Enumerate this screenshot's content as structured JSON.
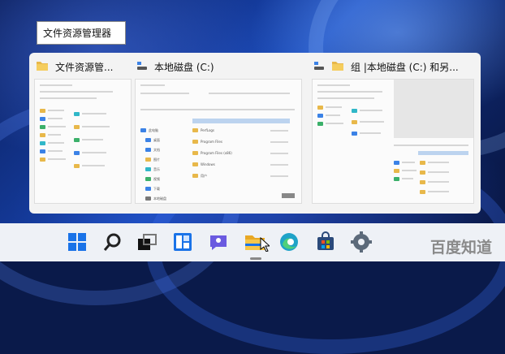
{
  "tooltip": {
    "label": "文件资源管理器"
  },
  "windows": [
    {
      "title": "文件资源管...",
      "icon": "folder-icon"
    },
    {
      "title": "本地磁盘 (C:)",
      "icon": "drive-icon"
    },
    {
      "title": "组 |本地磁盘 (C:) 和另...",
      "icon": "drive-icon"
    }
  ],
  "window2_preview": {
    "sidebar": [
      "此电脑",
      "桌面",
      "文档",
      "图片",
      "音乐",
      "视频",
      "下载",
      "本地磁盘"
    ],
    "files": [
      "PerfLogs",
      "Program Files",
      "Program Files (x86)",
      "Windows",
      "用户"
    ]
  },
  "taskbar": {
    "icons": [
      "windows-start-icon",
      "search-icon",
      "task-view-icon",
      "widgets-icon",
      "chat-icon",
      "file-explorer-icon",
      "edge-icon",
      "store-icon",
      "settings-icon"
    ],
    "active": "file-explorer-icon"
  },
  "watermark": "百度知道"
}
